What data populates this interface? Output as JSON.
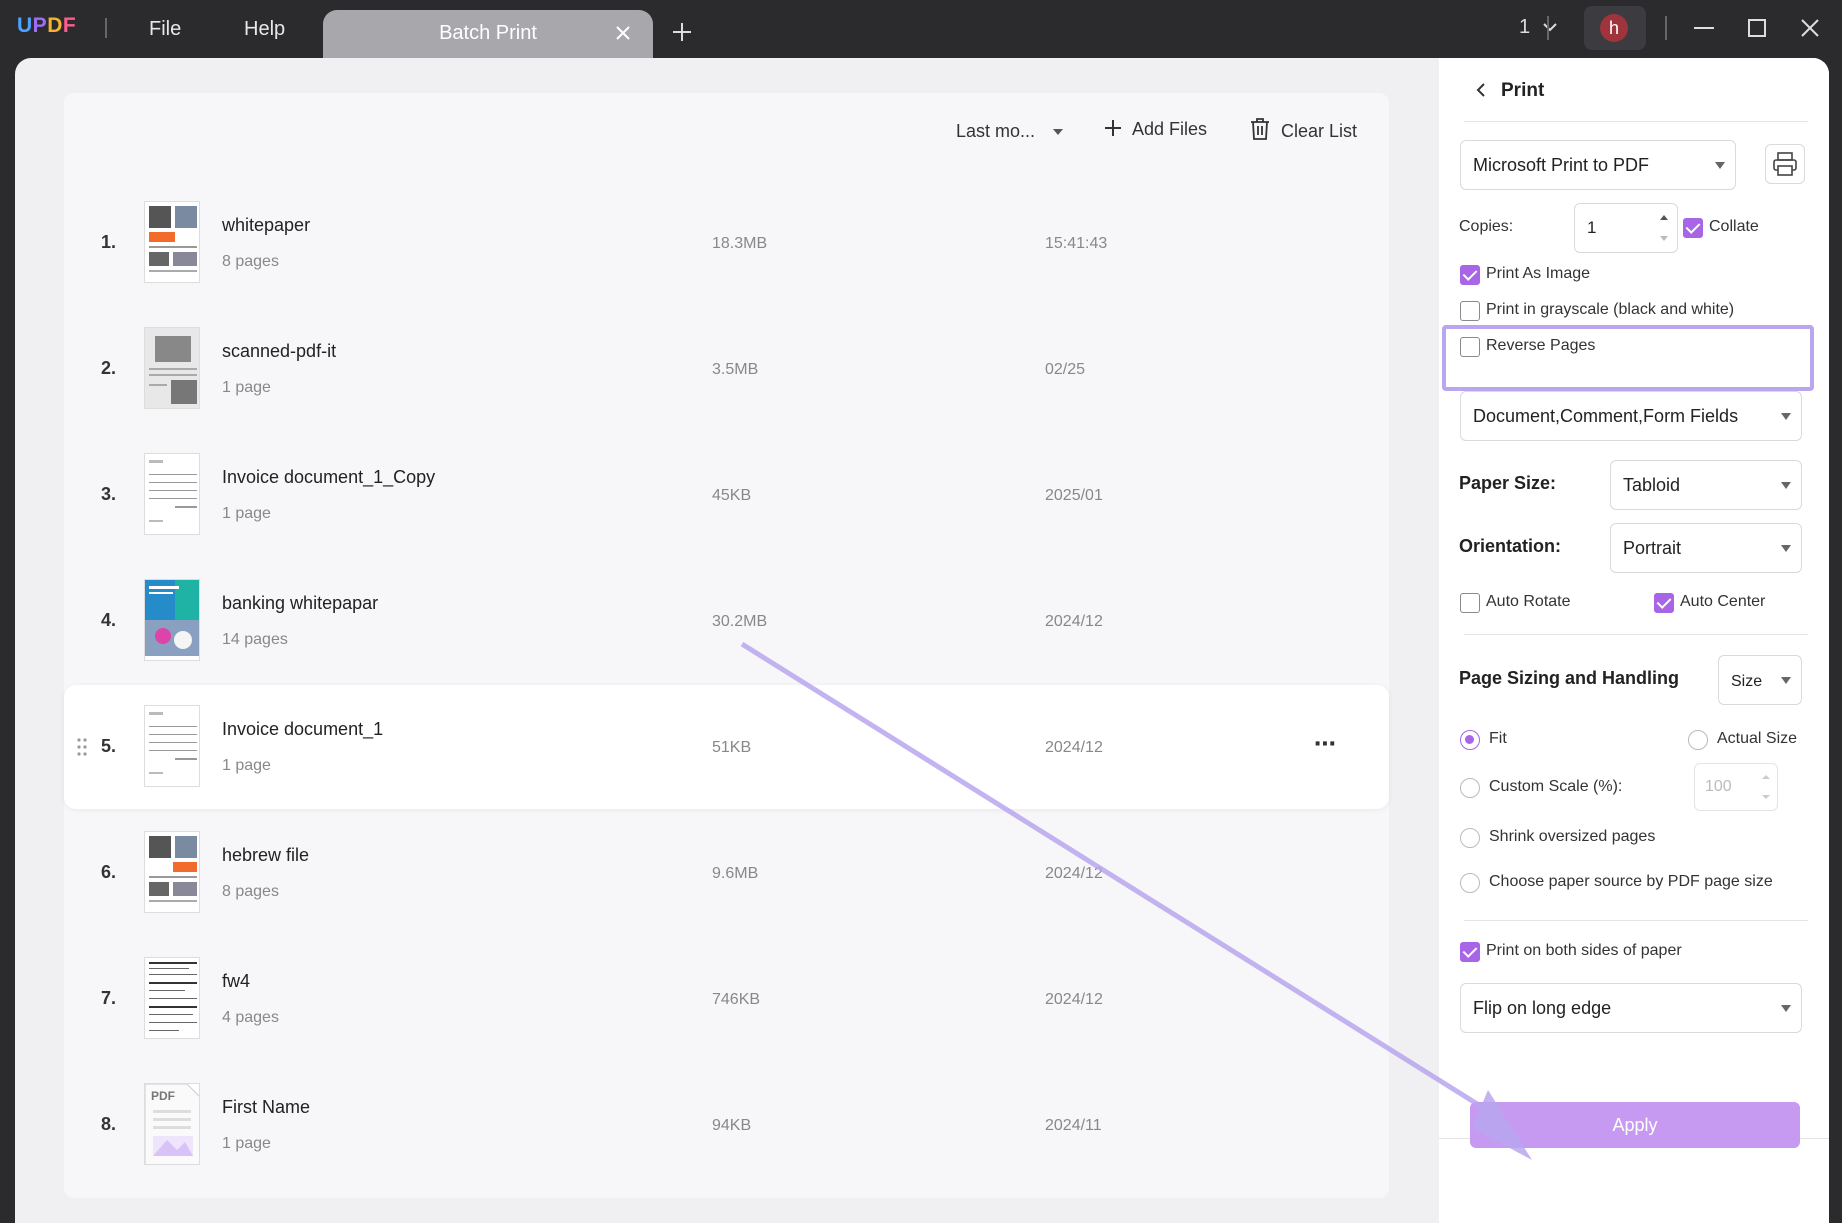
{
  "app": {
    "logo": "UPDF",
    "menu": [
      "File",
      "Help"
    ],
    "tab_title": "Batch Print",
    "page_indicator": "1",
    "avatar_letter": "h"
  },
  "toolbar": {
    "sort_label": "Last mo...",
    "add_files": "Add Files",
    "clear_list": "Clear List"
  },
  "files": [
    {
      "num": "1.",
      "name": "whitepaper",
      "pages": "8 pages",
      "size": "18.3MB",
      "date": "15:41:43"
    },
    {
      "num": "2.",
      "name": "scanned-pdf-it",
      "pages": "1 page",
      "size": "3.5MB",
      "date": "02/25"
    },
    {
      "num": "3.",
      "name": "Invoice document_1_Copy",
      "pages": "1 page",
      "size": "45KB",
      "date": "2025/01"
    },
    {
      "num": "4.",
      "name": "banking whitepapar",
      "pages": "14 pages",
      "size": "30.2MB",
      "date": "2024/12"
    },
    {
      "num": "5.",
      "name": "Invoice document_1",
      "pages": "1 page",
      "size": "51KB",
      "date": "2024/12"
    },
    {
      "num": "6.",
      "name": "hebrew file",
      "pages": "8 pages",
      "size": "9.6MB",
      "date": "2024/12"
    },
    {
      "num": "7.",
      "name": "fw4",
      "pages": "4 pages",
      "size": "746KB",
      "date": "2024/12"
    },
    {
      "num": "8.",
      "name": "First Name",
      "pages": "1 page",
      "size": "94KB",
      "date": "2024/11"
    }
  ],
  "print": {
    "header": "Print",
    "printer": "Microsoft Print to PDF",
    "copies_label": "Copies:",
    "copies_value": "1",
    "collate": "Collate",
    "print_as_image": "Print As Image",
    "grayscale": "Print in grayscale (black and white)",
    "reverse_pages": "Reverse Pages",
    "content": "Document,Comment,Form Fields",
    "paper_size_label": "Paper Size:",
    "paper_size": "Tabloid",
    "orientation_label": "Orientation:",
    "orientation": "Portrait",
    "auto_rotate": "Auto Rotate",
    "auto_center": "Auto Center",
    "sizing_title": "Page Sizing and Handling",
    "sizing_mode": "Size",
    "fit": "Fit",
    "actual_size": "Actual Size",
    "custom_scale": "Custom Scale (%):",
    "custom_scale_value": "100",
    "shrink": "Shrink oversized pages",
    "paper_source": "Choose paper source by PDF page size",
    "both_sides": "Print on both sides of paper",
    "flip": "Flip on long edge",
    "apply": "Apply"
  },
  "colors": {
    "accent": "#a865e6",
    "highlight": "#b9a6ee",
    "apply": "#c79af2"
  }
}
